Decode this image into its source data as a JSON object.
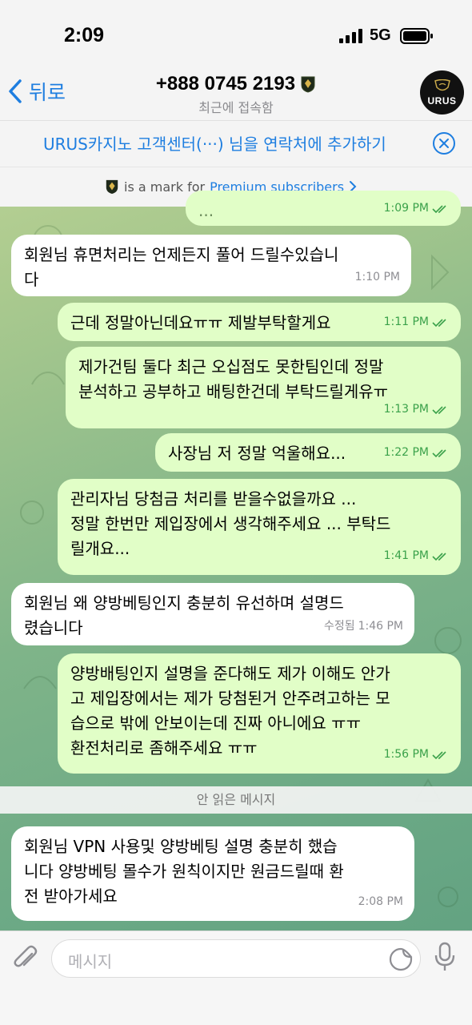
{
  "status": {
    "time": "2:09",
    "network": "5G"
  },
  "header": {
    "back_label": "뒤로",
    "title": "+888 0745 2193",
    "subtitle": "최근에 접속함",
    "avatar_text": "URUS"
  },
  "add_contact_banner": {
    "text": "URUS카지노 고객센터(···) 님을 연락처에 추가하기"
  },
  "premium_notice": {
    "text": "is a mark for",
    "link": "Premium subscribers"
  },
  "messages": [
    {
      "dir": "out",
      "text": "...",
      "time": "1:09 PM"
    },
    {
      "dir": "in",
      "text": "회원님 휴면처리는 언제든지 풀어 드릴수있습니\n다",
      "time": "1:10 PM"
    },
    {
      "dir": "out",
      "text": "근데 정말아닌데요ㅠㅠ 제발부탁할게요",
      "time": "1:11 PM"
    },
    {
      "dir": "out",
      "text": "제가건팀 둘다 최근 오십점도 못한팀인데 정말\n분석하고 공부하고 배팅한건데 부탁드릴게유ㅠ",
      "time": "1:13 PM"
    },
    {
      "dir": "out",
      "text": "사장님 저 정말 억울해요...",
      "time": "1:22 PM"
    },
    {
      "dir": "out",
      "text": "관리자님 당첨금 처리를 받을수없을까요 ...\n정말 한번만 제입장에서 생각해주세요 ... 부탁드\n릴개요...",
      "time": "1:41 PM"
    },
    {
      "dir": "in",
      "text": "회원님 왜 양방베팅인지 충분히 유선하며 설명드\n렸습니다",
      "time": "1:46 PM",
      "edited": "수정됨"
    },
    {
      "dir": "out",
      "text": "양방배팅인지 설명을 준다해도 제가 이해도 안가\n고 제입장에서는 제가 당첨된거 안주려고하는 모\n습으로 밖에 안보이는데 진짜 아니에요 ㅠㅠ\n환전처리로 좀해주세요 ㅠㅠ",
      "time": "1:56 PM"
    },
    {
      "dir": "in",
      "text": "회원님 VPN 사용및 양방베팅 설명 충분히 했습\n니다 양방베팅 몰수가 원칙이지만 원금드릴때 환\n전 받아가세요",
      "time": "2:08 PM"
    }
  ],
  "unread_divider": "안 읽은 메시지",
  "composer": {
    "placeholder": "메시지"
  },
  "colors": {
    "accent": "#1e7ee0",
    "outgoing_bubble": "#e1fec7",
    "incoming_bubble": "#ffffff",
    "read_check": "#3aa14a"
  }
}
